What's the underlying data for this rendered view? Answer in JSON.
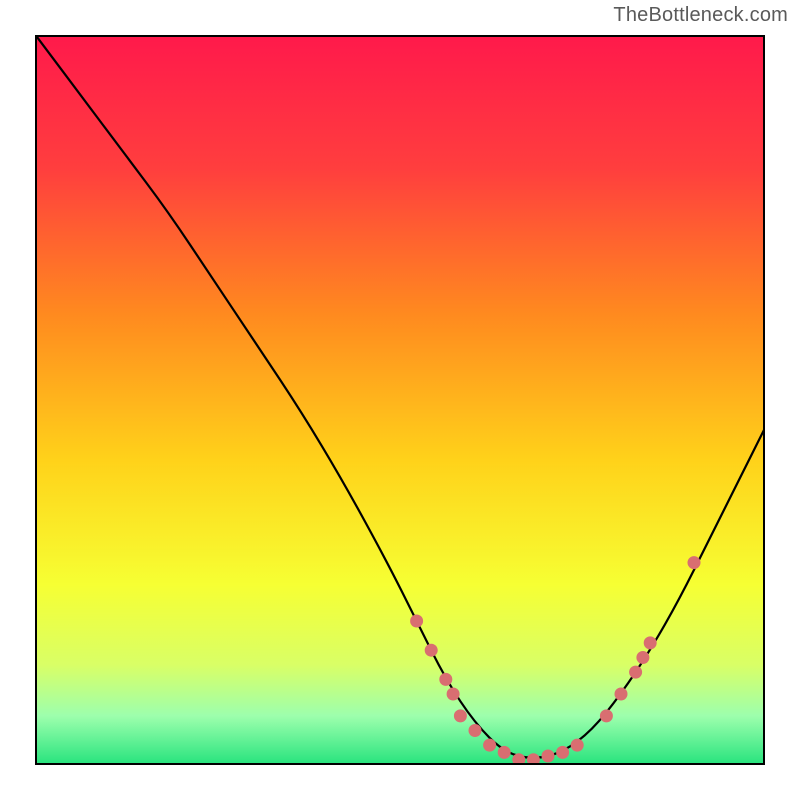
{
  "watermark": "TheBottleneck.com",
  "colors": {
    "gradient_stops": [
      {
        "offset": 0.0,
        "color": "#ff1a4b"
      },
      {
        "offset": 0.18,
        "color": "#ff3e3e"
      },
      {
        "offset": 0.38,
        "color": "#ff8a1f"
      },
      {
        "offset": 0.58,
        "color": "#ffd21a"
      },
      {
        "offset": 0.75,
        "color": "#f6ff33"
      },
      {
        "offset": 0.86,
        "color": "#d9ff66"
      },
      {
        "offset": 0.93,
        "color": "#9dffad"
      },
      {
        "offset": 1.0,
        "color": "#21e27b"
      }
    ],
    "curve": "#000000",
    "dot": "#d96e71",
    "frame": "#000000"
  },
  "chart_data": {
    "type": "line",
    "title": "",
    "xlabel": "",
    "ylabel": "",
    "xlim": [
      0,
      100
    ],
    "ylim": [
      0,
      100
    ],
    "x": [
      0,
      6,
      12,
      18,
      24,
      30,
      36,
      42,
      48,
      52,
      56,
      60,
      64,
      68,
      72,
      76,
      80,
      84,
      88,
      92,
      96,
      100
    ],
    "values": [
      100,
      92,
      84,
      76,
      67,
      58,
      49,
      39,
      28,
      20,
      12,
      6,
      2,
      1,
      2,
      5,
      10,
      16,
      23,
      31,
      39,
      47
    ],
    "series": [
      {
        "name": "bottleneck-curve",
        "x": [
          0,
          6,
          12,
          18,
          24,
          30,
          36,
          42,
          48,
          52,
          56,
          60,
          64,
          68,
          72,
          76,
          80,
          84,
          88,
          92,
          96,
          100
        ],
        "y": [
          100,
          92,
          84,
          76,
          67,
          58,
          49,
          39,
          28,
          20,
          12,
          6,
          2,
          1,
          2,
          5,
          10,
          16,
          23,
          31,
          39,
          47
        ]
      }
    ],
    "scatter_points": [
      {
        "x": 52,
        "y": 20
      },
      {
        "x": 54,
        "y": 16
      },
      {
        "x": 56,
        "y": 12
      },
      {
        "x": 57,
        "y": 10
      },
      {
        "x": 58,
        "y": 7
      },
      {
        "x": 60,
        "y": 5
      },
      {
        "x": 62,
        "y": 3
      },
      {
        "x": 64,
        "y": 2
      },
      {
        "x": 66,
        "y": 1
      },
      {
        "x": 68,
        "y": 1
      },
      {
        "x": 70,
        "y": 1.5
      },
      {
        "x": 72,
        "y": 2
      },
      {
        "x": 74,
        "y": 3
      },
      {
        "x": 78,
        "y": 7
      },
      {
        "x": 80,
        "y": 10
      },
      {
        "x": 82,
        "y": 13
      },
      {
        "x": 83,
        "y": 15
      },
      {
        "x": 84,
        "y": 17
      },
      {
        "x": 90,
        "y": 28
      }
    ]
  }
}
